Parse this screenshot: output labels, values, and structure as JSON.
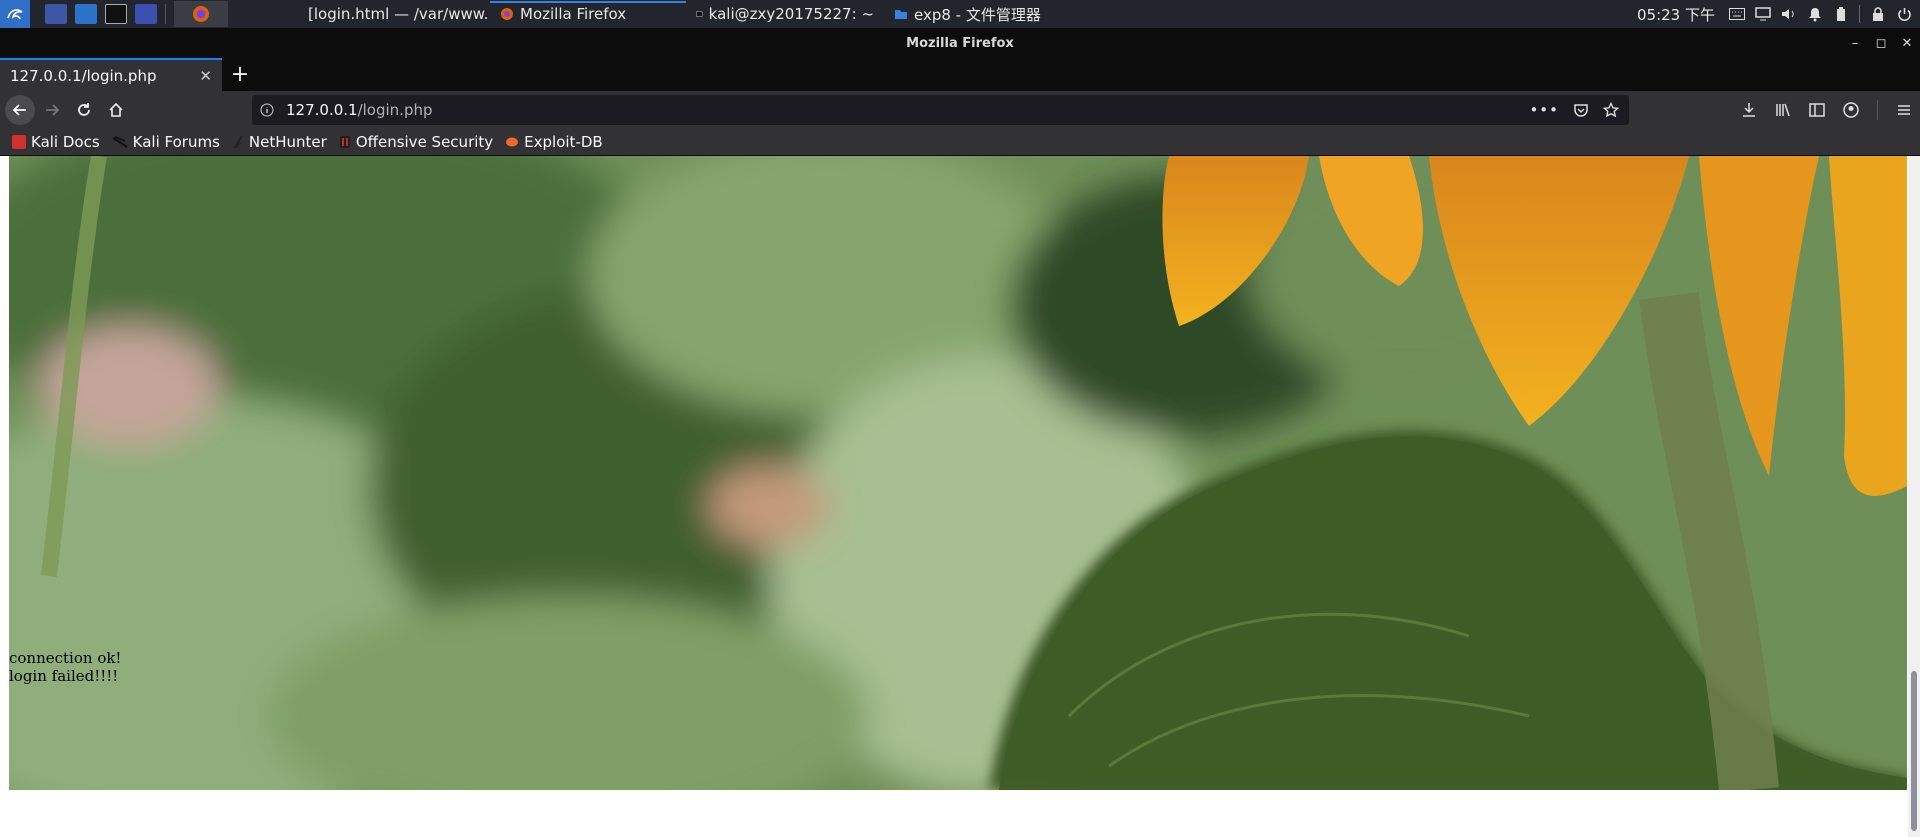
{
  "taskbar": {
    "tasks": [
      {
        "label": "[login.html — /var/www..."
      },
      {
        "label": "Mozilla Firefox"
      },
      {
        "label": "kali@zxy20175227: ~"
      },
      {
        "label": "exp8 - 文件管理器"
      }
    ],
    "clock": "05:23 下午"
  },
  "window": {
    "title": "Mozilla Firefox"
  },
  "browser": {
    "tab_title": "127.0.0.1/login.php",
    "url_host": "127.0.0.1",
    "url_path": "/login.php",
    "bookmarks": [
      {
        "label": "Kali Docs",
        "color": "#d32f2f"
      },
      {
        "label": "Kali Forums",
        "color": "#444444"
      },
      {
        "label": "NetHunter",
        "color": "#333333"
      },
      {
        "label": "Offensive Security",
        "color": "#8a3b2a"
      },
      {
        "label": "Exploit-DB",
        "color": "#f0692b"
      }
    ]
  },
  "page": {
    "messages": [
      "connection ok!",
      "login failed!!!!"
    ]
  },
  "colors": {
    "accent": "#0a84ff",
    "panel": "#22252b",
    "toolbar": "#323234"
  }
}
